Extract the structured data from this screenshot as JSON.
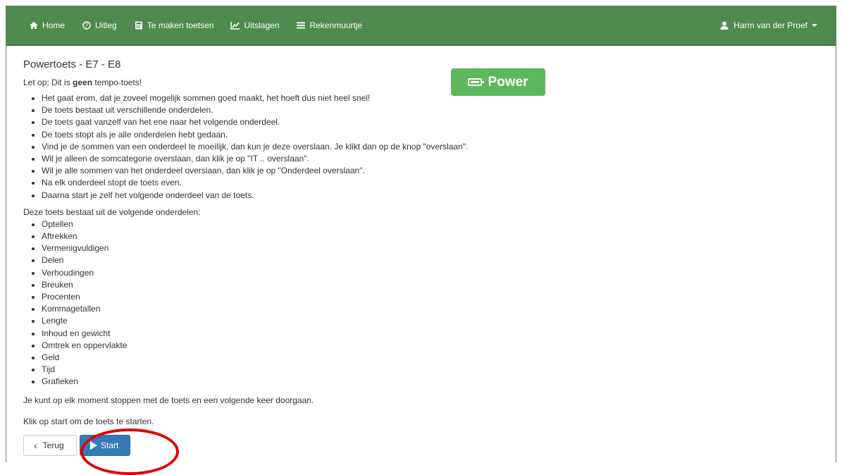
{
  "nav": {
    "items": [
      {
        "label": "Home",
        "icon": "home-icon"
      },
      {
        "label": "Uitleg",
        "icon": "question-icon"
      },
      {
        "label": "Te maken toetsen",
        "icon": "calculator-icon"
      },
      {
        "label": "Uitslagen",
        "icon": "chart-icon"
      },
      {
        "label": "Rekenmuurtje",
        "icon": "menu-icon"
      }
    ],
    "user": "Harm van der Proef",
    "user_icon": "user-icon"
  },
  "page": {
    "title": "Powertoets - E7 - E8",
    "intro_prefix": "Let op; Dit is ",
    "intro_bold": "geen",
    "intro_suffix": " tempo-toets!",
    "badge_label": "Power",
    "badge_icon": "battery-icon",
    "badge_color": "#5cb85c",
    "rules": [
      "Het gaat erom, dat je zoveel mogelijk sommen goed maakt, het hoeft dus niet heel snel!",
      "De toets bestaat uit verschillende onderdelen.",
      "De toets gaat vanzelf van het ene naar het volgende onderdeel.",
      "De toets stopt als je alle onderdelen hebt gedaan.",
      "Vind je de sommen van een onderdeel te moeilijk, dan kun je deze overslaan. Je klikt dan op de knop \"overslaan\".",
      "Wil je alleen de somcategorie overslaan, dan klik je op \"IT .. overslaan\".",
      "Wil je alle sommen van het onderdeel overslaan, dan klik je op \"Onderdeel overslaan\".",
      "Na elk onderdeel stopt de toets even.",
      "Daarna start je zelf het volgende onderdeel van de toets."
    ],
    "parts_heading": "Deze toets bestaat uit de volgende onderdelen:",
    "parts": [
      "Optellen",
      "Aftrekken",
      "Vermenigvuldigen",
      "Delen",
      "Verhoudingen",
      "Breuken",
      "Procenten",
      "Kommagetallen",
      "Lengte",
      "Inhoud en gewicht",
      "Omtrek en oppervlakte",
      "Geld",
      "Tijd",
      "Grafieken"
    ],
    "stop_note": "Je kunt op elk moment stoppen met de toets en een volgende keer doorgaan.",
    "start_note": "Klik op start om de toets te starten."
  },
  "buttons": {
    "back_label": "Terug",
    "start_label": "Start"
  },
  "colors": {
    "navbar": "#4f8a4f",
    "start_button": "#337ab7",
    "annotation_circle": "#e00000"
  }
}
